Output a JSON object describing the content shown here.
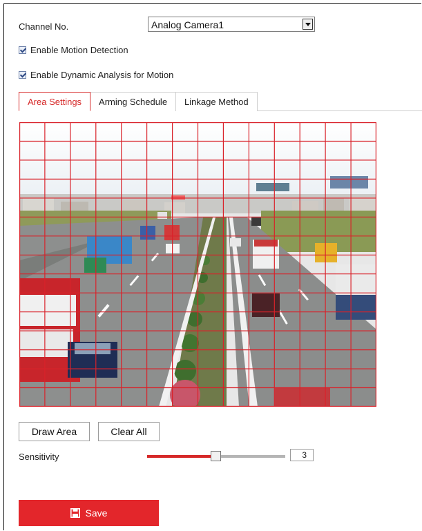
{
  "channel": {
    "label": "Channel No.",
    "selected": "Analog Camera1"
  },
  "options": {
    "enable_motion": "Enable Motion Detection",
    "enable_dynamic": "Enable Dynamic Analysis for Motion"
  },
  "tabs": [
    {
      "label": "Area Settings",
      "active": true
    },
    {
      "label": "Arming Schedule",
      "active": false
    },
    {
      "label": "Linkage Method",
      "active": false
    }
  ],
  "buttons": {
    "draw_area": "Draw Area",
    "clear_all": "Clear All",
    "save": "Save"
  },
  "sensitivity": {
    "label": "Sensitivity",
    "value": "3",
    "level": 0.5
  },
  "colors": {
    "accent": "#d62828",
    "save": "#e3262b",
    "grid": "#d9222a"
  },
  "icons": {
    "save": "floppy-disk-icon",
    "dropdown": "chevron-down-icon"
  }
}
